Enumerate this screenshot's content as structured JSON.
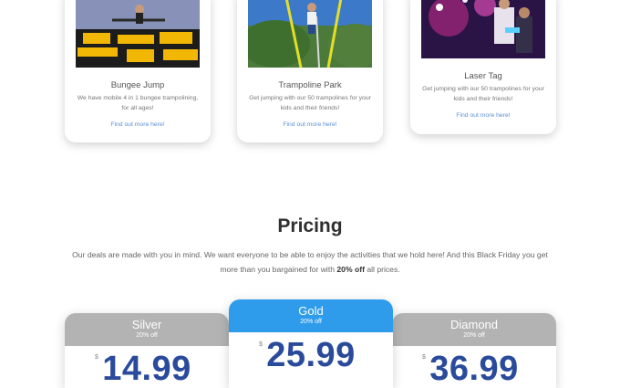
{
  "activities": [
    {
      "title": "Bungee Jump",
      "description": "We have mobile 4 in 1 bungee trampolining, for all ages!",
      "link": "Find out more here!",
      "image_alt": "bungee-photo"
    },
    {
      "title": "Trampoline Park",
      "description": "Get jumping with our 50 trampolines for your kids and their friends!",
      "link": "Find out more here!",
      "image_alt": "trampoline-photo"
    },
    {
      "title": "Laser Tag",
      "description": "Get jumping with our 50 trampolines for your kids and their friends!",
      "link": "Find out more here!",
      "image_alt": "laser-tag-photo"
    }
  ],
  "pricing": {
    "heading": "Pricing",
    "intro_part1": "Our deals are made with you in mind. We want everyone to be able to enjoy the activities that we hold here! And this Black Friday you get more than you bargained for with ",
    "intro_bold": "20% off",
    "intro_part2": " all prices.",
    "plans": [
      {
        "name": "Silver",
        "discount": "20% off",
        "currency": "$",
        "price": "14.99",
        "header_color": "#b3b3b3"
      },
      {
        "name": "Gold",
        "discount": "20% off",
        "currency": "$",
        "price": "25.99",
        "header_color": "#2f9ceb"
      },
      {
        "name": "Diamond",
        "discount": "20% off",
        "currency": "$",
        "price": "36.99",
        "header_color": "#b3b3b3"
      }
    ]
  }
}
